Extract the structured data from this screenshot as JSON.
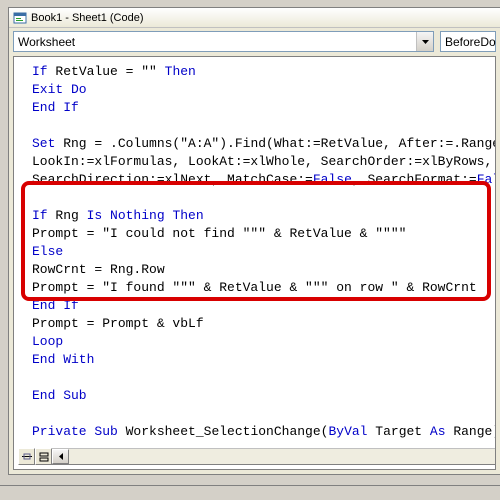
{
  "window": {
    "title": "Book1 - Sheet1 (Code)"
  },
  "dropdowns": {
    "object": "Worksheet",
    "procedure": "BeforeDo"
  },
  "code": {
    "l1a": "If",
    "l1b": " RetValue = \"\" ",
    "l1c": "Then",
    "l2": "Exit Do",
    "l3": "End If",
    "l4": "",
    "l5a": "Set",
    "l5b": " Rng = .Columns(\"A:A\").Find(What:=RetValue, After:=.Range(\"",
    "l6a": "LookIn:=xlFormulas, LookAt:=xlWhole, SearchOrder:=xlByRows, _",
    "l7a": "SearchDirection:=xlNext, MatchCase:=",
    "l7b": "False",
    "l7c": ", SearchFormat:=",
    "l7d": "False",
    "l8": "",
    "l9a": "If",
    "l9b": " Rng ",
    "l9c": "Is Nothing Then",
    "l10": "Prompt = \"I could not find \"\"\" & RetValue & \"\"\"\"",
    "l11": "Else",
    "l12": "RowCrnt = Rng.Row",
    "l13": "Prompt = \"I found \"\"\" & RetValue & \"\"\" on row \" & RowCrnt",
    "l14": "End If",
    "l15": "Prompt = Prompt & vbLf",
    "l16": "Loop",
    "l17": "End With",
    "l18": "",
    "l19": "End Sub",
    "l20": "",
    "l21a": "Private Sub",
    "l21b": " Worksheet_SelectionChange(",
    "l21c": "ByVal",
    "l21d": " Target ",
    "l21e": "As",
    "l21f": " Range)"
  }
}
